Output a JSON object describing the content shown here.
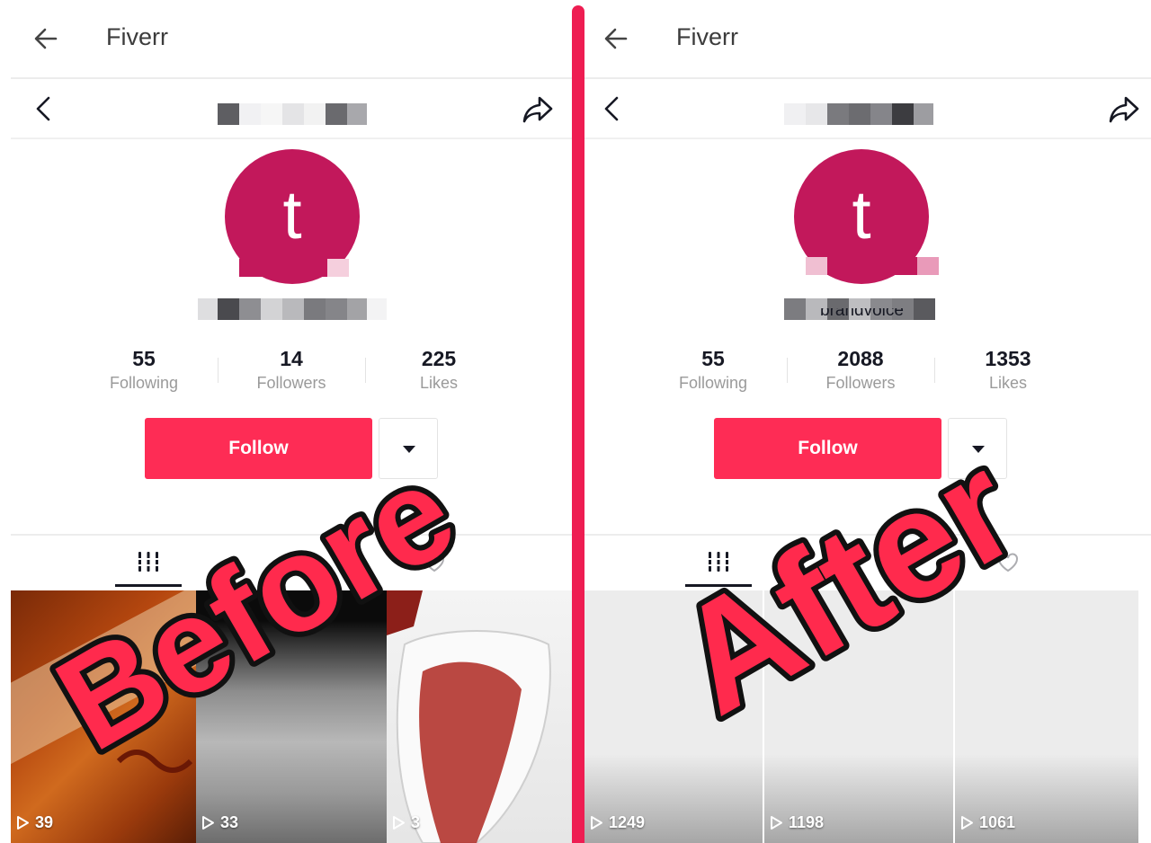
{
  "before": {
    "appbar": {
      "title": "Fiverr"
    },
    "avatar_letter": "t",
    "stats": [
      {
        "value": "55",
        "label": "Following"
      },
      {
        "value": "14",
        "label": "Followers"
      },
      {
        "value": "225",
        "label": "Likes"
      }
    ],
    "follow_label": "Follow",
    "videos": [
      {
        "views": "39"
      },
      {
        "views": "33"
      },
      {
        "views": "3"
      }
    ]
  },
  "after": {
    "appbar": {
      "title": "Fiverr"
    },
    "avatar_letter": "t",
    "username_partial": "brandvoice",
    "stats": [
      {
        "value": "55",
        "label": "Following"
      },
      {
        "value": "2088",
        "label": "Followers"
      },
      {
        "value": "1353",
        "label": "Likes"
      }
    ],
    "follow_label": "Follow",
    "videos": [
      {
        "views": "1249"
      },
      {
        "views": "1198"
      },
      {
        "views": "1061"
      }
    ]
  },
  "overlay": {
    "before_label": "Before",
    "after_label": "After"
  },
  "colors": {
    "accent": "#fe2c55",
    "avatar": "#c2185b",
    "divider": "#ee1d52",
    "overlay_fill": "#ff2a4d",
    "overlay_stroke": "#111111"
  },
  "icons": [
    "arrow-left-icon",
    "chevron-left-icon",
    "share-icon",
    "grid-icon",
    "liked-icon",
    "play-icon",
    "dropdown-icon"
  ]
}
